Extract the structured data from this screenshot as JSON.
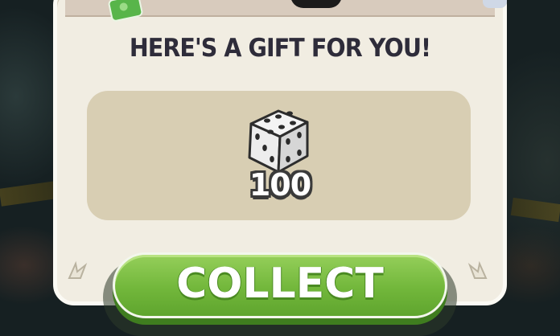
{
  "popup": {
    "title": "HERE'S A GIFT FOR YOU!",
    "reward": {
      "icon": "dice-icon",
      "count": "100"
    },
    "collect_button": {
      "label": "COLLECT"
    }
  },
  "colors": {
    "panel": "#f1ede2",
    "reward_box": "#d8ceb3",
    "button_green": "#72b73b",
    "title_text": "#2e2c3a"
  }
}
